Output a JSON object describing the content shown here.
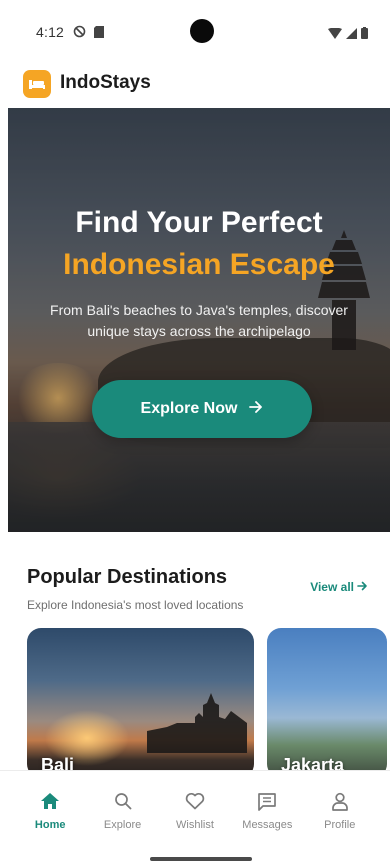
{
  "status_bar": {
    "time": "4:12"
  },
  "app": {
    "name": "IndoStays"
  },
  "hero": {
    "title_line1": "Find Your Perfect",
    "title_line2": "Indonesian Escape",
    "subtitle": "From Bali's beaches to Java's temples, discover unique stays across the archipelago",
    "cta_label": "Explore Now"
  },
  "popular": {
    "title": "Popular Destinations",
    "subtitle": "Explore Indonesia's most loved locations",
    "view_all": "View all",
    "cards": [
      {
        "name": "Bali"
      },
      {
        "name": "Jakarta"
      }
    ]
  },
  "nav": {
    "items": [
      {
        "label": "Home",
        "icon": "home-icon",
        "active": true
      },
      {
        "label": "Explore",
        "icon": "search-icon",
        "active": false
      },
      {
        "label": "Wishlist",
        "icon": "heart-icon",
        "active": false
      },
      {
        "label": "Messages",
        "icon": "message-icon",
        "active": false
      },
      {
        "label": "Profile",
        "icon": "person-icon",
        "active": false
      }
    ]
  },
  "colors": {
    "accent": "#1a8a7b",
    "brand_orange": "#f5a524"
  }
}
